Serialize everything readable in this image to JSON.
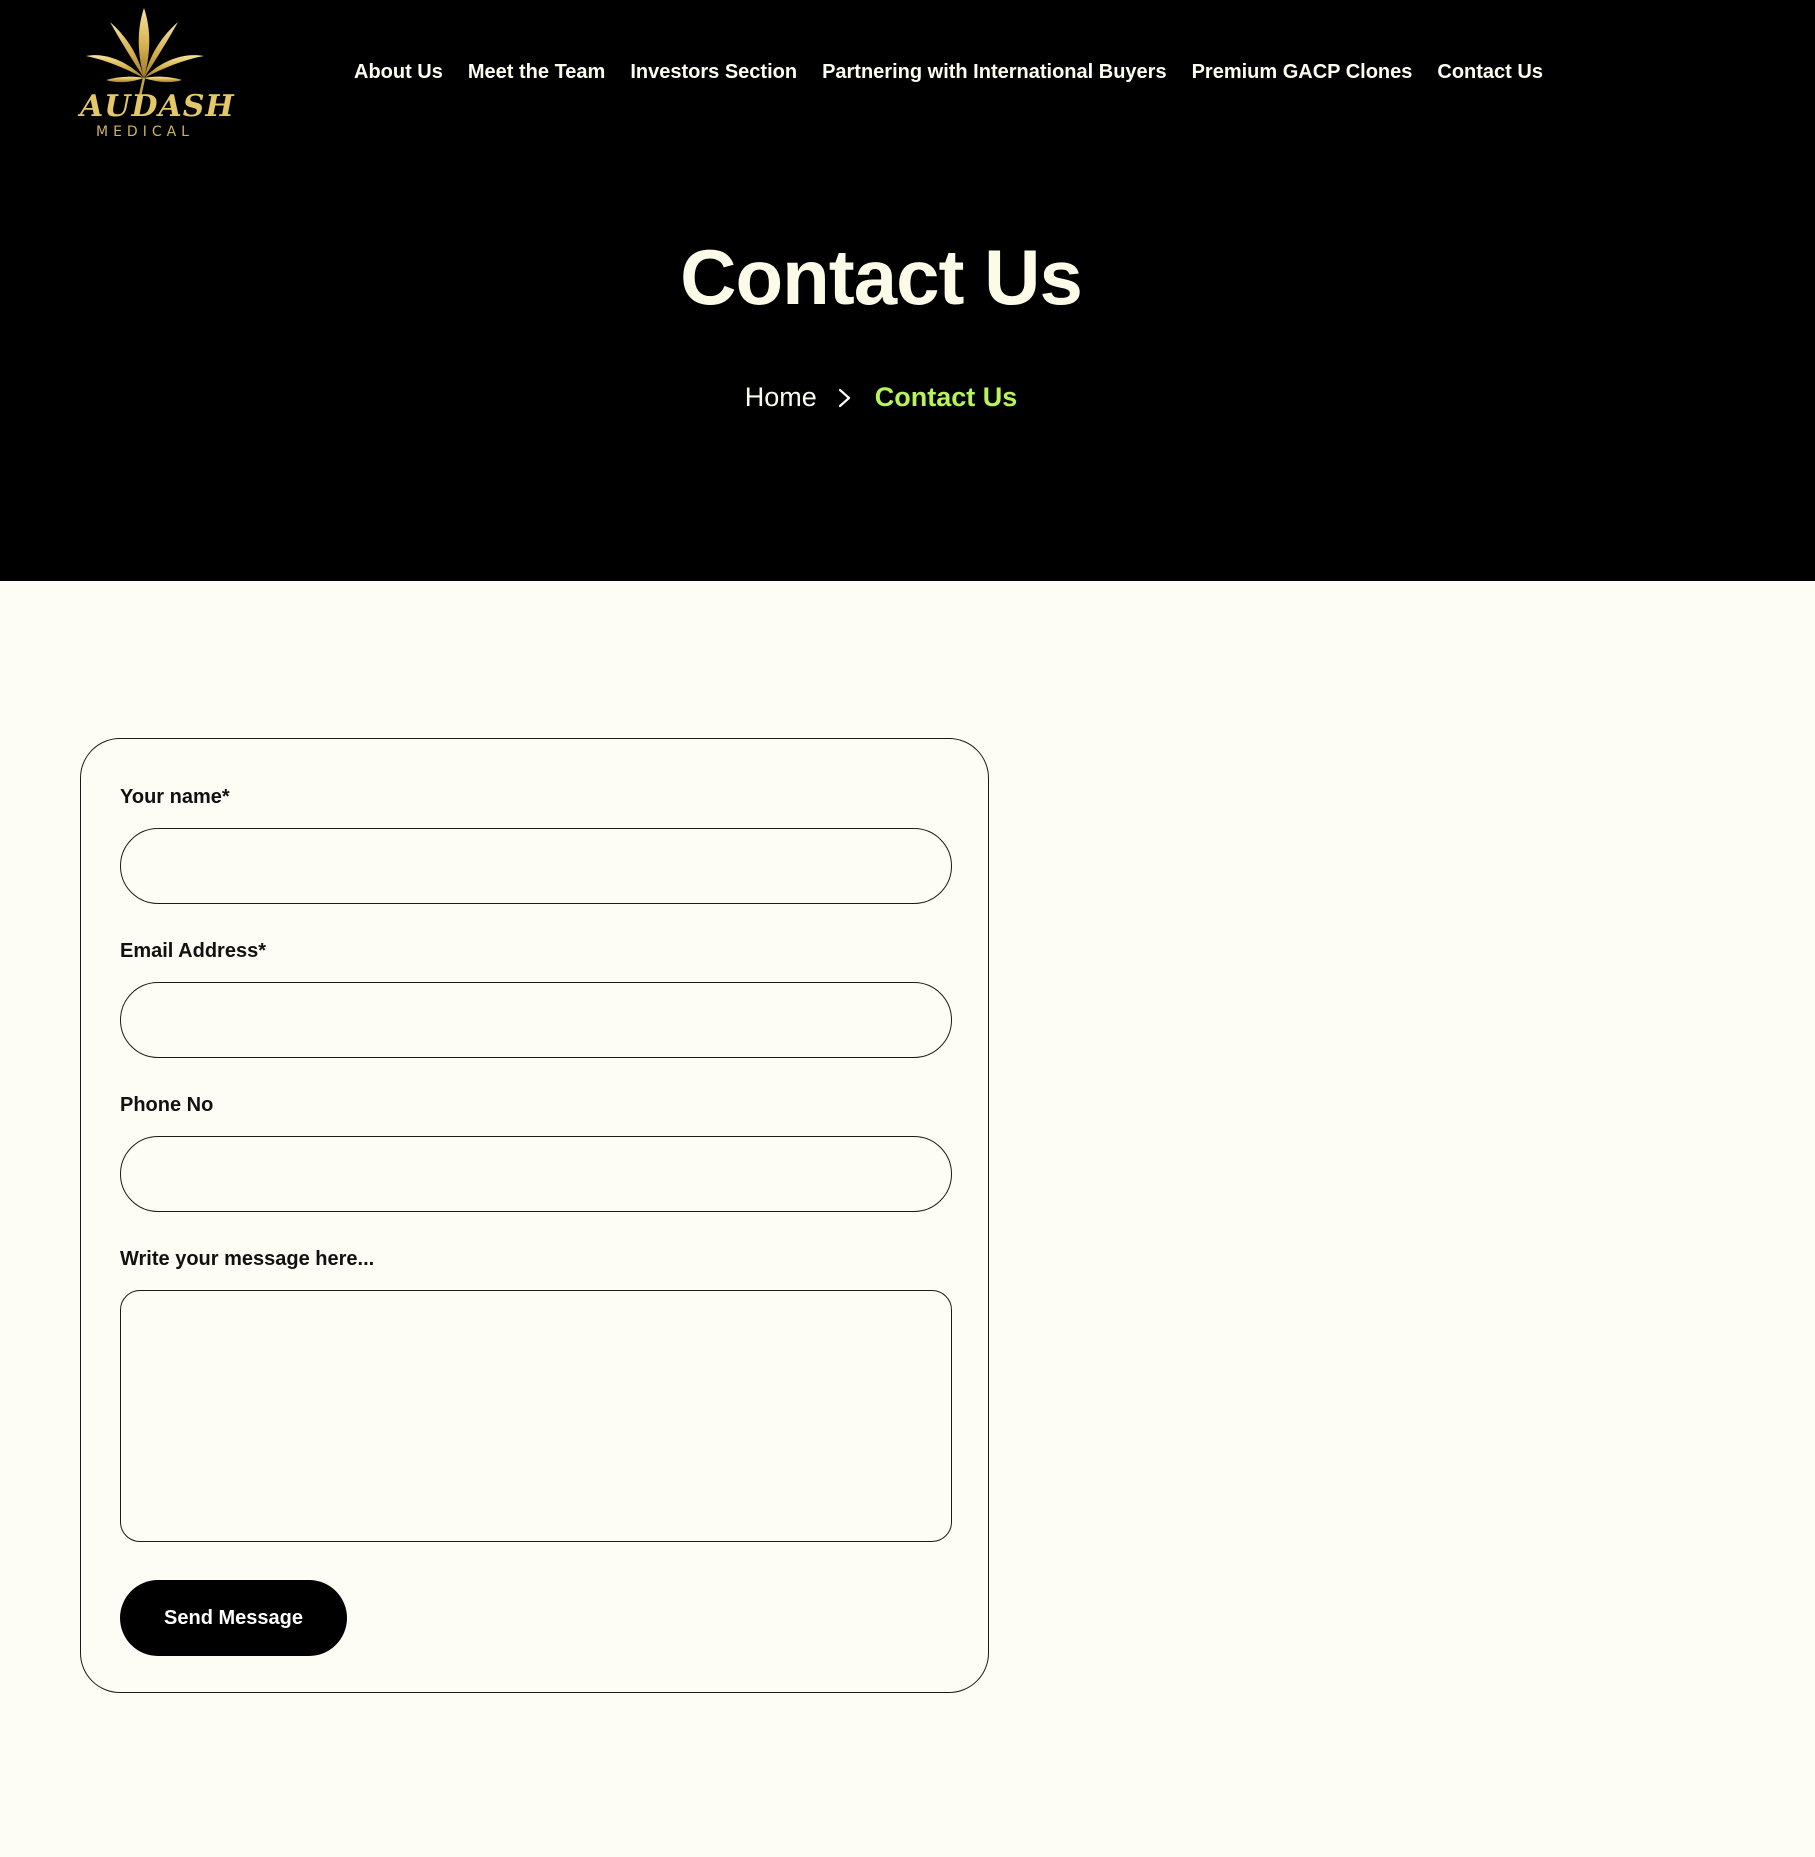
{
  "brand": {
    "name": "AUDASH",
    "subtitle": "MEDICAL",
    "colors": {
      "gold": "#E4C767",
      "accent_green": "#B7F35A",
      "hero_bg": "#000000",
      "page_bg": "#FDFDF5"
    }
  },
  "nav": {
    "items": [
      {
        "label": "About Us"
      },
      {
        "label": "Meet the Team"
      },
      {
        "label": "Investors Section"
      },
      {
        "label": "Partnering with International Buyers"
      },
      {
        "label": "Premium GACP Clones"
      },
      {
        "label": "Contact Us"
      }
    ]
  },
  "hero": {
    "title": "Contact Us"
  },
  "breadcrumb": {
    "home": "Home",
    "separator_icon": "chevron-right-icon",
    "current": "Contact Us"
  },
  "form": {
    "name_label": "Your name*",
    "name_value": "",
    "email_label": "Email Address*",
    "email_value": "",
    "phone_label": "Phone No",
    "phone_value": "",
    "message_label": "Write your message here...",
    "message_value": "",
    "submit_label": "Send Message"
  }
}
